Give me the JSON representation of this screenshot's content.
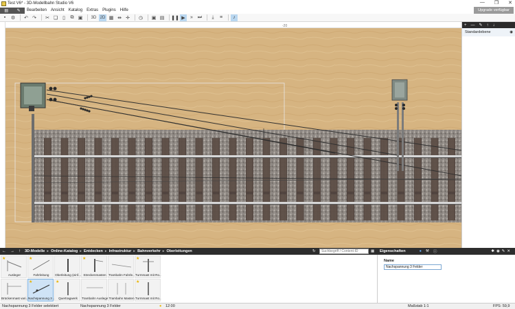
{
  "window": {
    "title": "Test V6* - 3D-Modellbahn Studio V6",
    "controls": [
      "—",
      "❐",
      "✕"
    ]
  },
  "menu": {
    "items": [
      "Bearbeiten",
      "Ansicht",
      "Katalog",
      "Extras",
      "Plugins",
      "Hilfe"
    ],
    "upgrade": "Upgrade verfügbar"
  },
  "toolbar": {
    "label_3d": "3D",
    "label_2d": "2D"
  },
  "ruler": {
    "tick": "-20"
  },
  "layers": {
    "name": "Standardebene"
  },
  "catalog": {
    "breadcrumb": [
      "3D-Modelle",
      "Online-Katalog",
      "Entdecken",
      "Infrastruktur",
      "Bahnverkehr",
      "Oberleitungen"
    ],
    "search_placeholder": "Suchbegriff / Content-ID",
    "items": [
      {
        "label": "Ausleger",
        "star": true,
        "selected": false
      },
      {
        "label": "Fahrleitung",
        "star": true,
        "selected": false
      },
      {
        "label": "Oberleitung (einf...",
        "star": false,
        "selected": false
      },
      {
        "label": "Streckenmasten",
        "star": true,
        "selected": false
      },
      {
        "label": "Trambahn Fahrle...",
        "star": false,
        "selected": false
      },
      {
        "label": "Turmmast mit Ro...",
        "star": true,
        "selected": false
      },
      {
        "label": "Brückenmast vari...",
        "star": false,
        "selected": false
      },
      {
        "label": "Nachspannung 3 ...",
        "star": true,
        "selected": true
      },
      {
        "label": "Quertragwerk",
        "star": true,
        "selected": false
      },
      {
        "label": "Trambahn Ausleger",
        "star": false,
        "selected": false
      },
      {
        "label": "Trambahn Masten",
        "star": false,
        "selected": false
      },
      {
        "label": "Turmmast mit Ro...",
        "star": true,
        "selected": false
      }
    ]
  },
  "properties": {
    "title": "Eigenschaften",
    "name_label": "Name",
    "name_value": "Nachspannung 3 Felder"
  },
  "status": {
    "selection": "Nachspannung 3 Felder selektiert",
    "object": "Nachspannung 3 Felder",
    "time": "12:00",
    "scale": "Maßstab 1:1",
    "fps": "FPS: 59,9"
  },
  "colors": {
    "accent": "#1e90ff",
    "dark_panel": "#2d2d2d",
    "sand": "#d9b985"
  }
}
